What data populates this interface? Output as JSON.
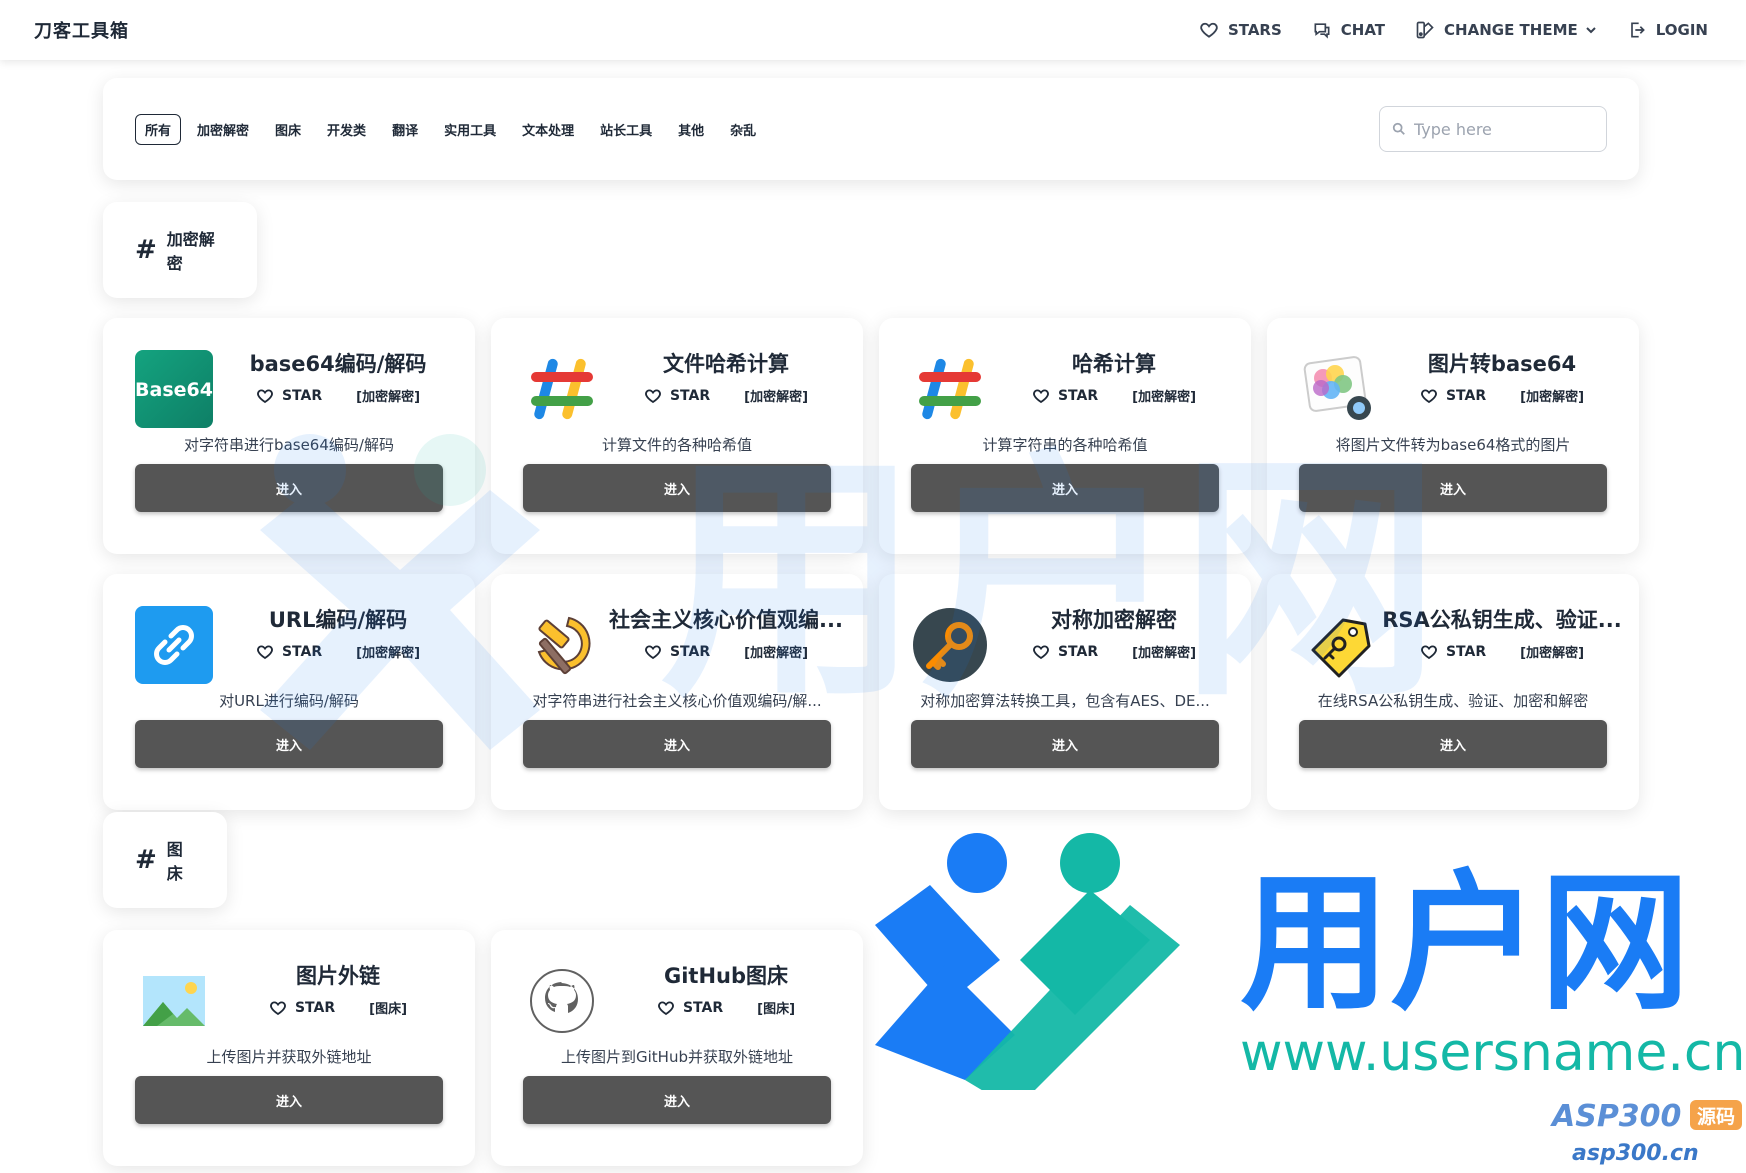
{
  "brand": "刀客工具箱",
  "nav": {
    "stars": "STARS",
    "chat": "CHAT",
    "change_theme": "CHANGE THEME",
    "login": "LOGIN"
  },
  "tabs": [
    "所有",
    "加密解密",
    "图床",
    "开发类",
    "翻译",
    "实用工具",
    "文本处理",
    "站长工具",
    "其他",
    "杂乱"
  ],
  "search": {
    "placeholder": "Type here"
  },
  "common": {
    "star": "STAR",
    "enter": "进入"
  },
  "sections": [
    {
      "title": "加密解密",
      "cards": [
        {
          "name": "base64编码/解码",
          "tag": "[加密解密]",
          "desc": "对字符串进行base64编码/解码",
          "icon": "base64-icon"
        },
        {
          "name": "文件哈希计算",
          "tag": "[加密解密]",
          "desc": "计算文件的各种哈希值",
          "icon": "hash-icon"
        },
        {
          "name": "哈希计算",
          "tag": "[加密解密]",
          "desc": "计算字符串的各种哈希值",
          "icon": "hash-icon"
        },
        {
          "name": "图片转base64",
          "tag": "[加密解密]",
          "desc": "将图片文件转为base64格式的图片",
          "icon": "image-convert-icon"
        },
        {
          "name": "URL编码/解码",
          "tag": "[加密解密]",
          "desc": "对URL进行编码/解码",
          "icon": "link-icon"
        },
        {
          "name": "社会主义核心价值观编...",
          "tag": "[加密解密]",
          "desc": "对字符串进行社会主义核心价值观编码/解...",
          "icon": "hammer-sickle-icon"
        },
        {
          "name": "对称加密解密",
          "tag": "[加密解密]",
          "desc": "对称加密算法转换工具，包含有AES、DE...",
          "icon": "key-icon"
        },
        {
          "name": "RSA公私钥生成、验证...",
          "tag": "[加密解密]",
          "desc": "在线RSA公私钥生成、验证、加密和解密",
          "icon": "tag-key-icon"
        }
      ]
    },
    {
      "title": "图床",
      "cards": [
        {
          "name": "图片外链",
          "tag": "[图床]",
          "desc": "上传图片并获取外链地址",
          "icon": "landscape-image-icon"
        },
        {
          "name": "GitHub图床",
          "tag": "[图床]",
          "desc": "上传图片到GitHub并获取外链地址",
          "icon": "github-icon"
        }
      ]
    }
  ],
  "watermark": {
    "site_name": "用户网",
    "site_url": "www.usersname.cn",
    "asp_badge": "ASP300",
    "asp_badge_tag": "源码",
    "asp_url": "asp300.cn"
  },
  "colors": {
    "button_bg": "#555555",
    "brand_blue": "#1a7cf5",
    "brand_teal": "#14b8a6"
  }
}
